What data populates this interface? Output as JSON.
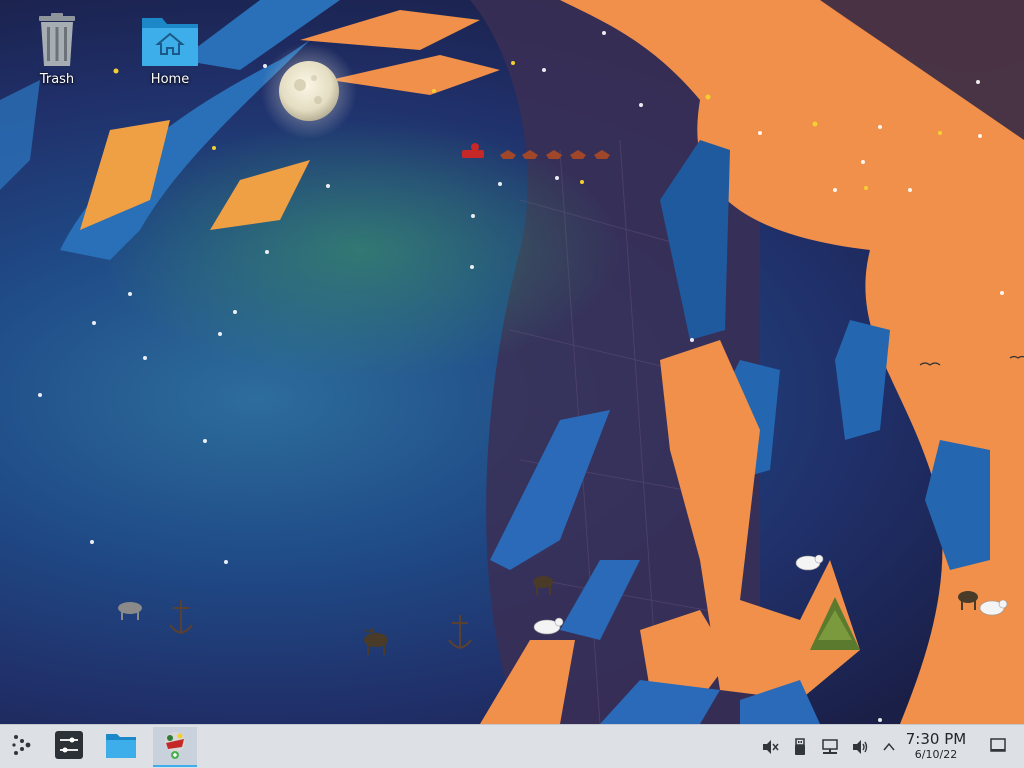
{
  "desktop": {
    "icons": [
      {
        "label": "Trash",
        "icon": "trash-icon"
      },
      {
        "label": "Home",
        "icon": "home-folder-icon"
      }
    ],
    "wallpaper": "winter-holiday-wallpaper"
  },
  "taskbar": {
    "launcher_icon": "app-launcher-icon",
    "tasks": [
      {
        "name": "system-settings",
        "icon": "settings-sliders-icon"
      },
      {
        "name": "dolphin-file-manager",
        "icon": "folder-icon"
      },
      {
        "name": "xsnow",
        "icon": "santa-sleigh-icon"
      }
    ],
    "tray": [
      "muted-speaker-icon",
      "usb-device-icon",
      "network-wired-icon",
      "volume-icon",
      "expand-tray-icon"
    ],
    "clock": {
      "time": "7:30 PM",
      "date": "6/10/22"
    },
    "show_desktop_icon": "show-desktop-icon"
  },
  "colors": {
    "accent": "#3daee9",
    "panel": "#dde1e6",
    "orange": "#f0904a"
  }
}
